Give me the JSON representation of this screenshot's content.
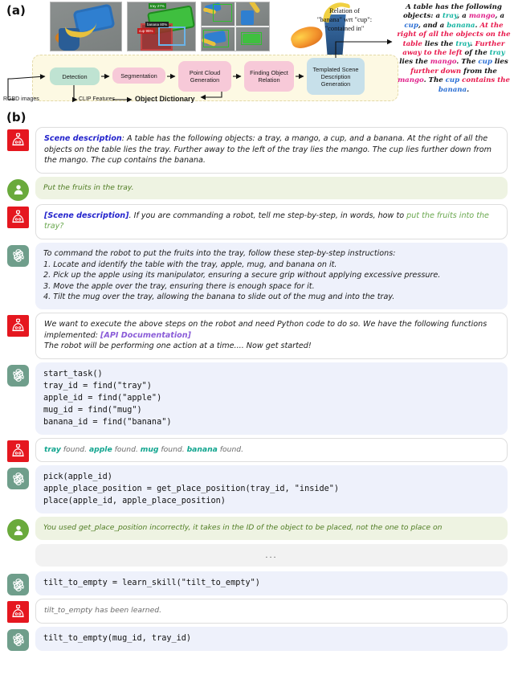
{
  "panels": {
    "a": "(a)",
    "b": "(b)"
  },
  "pipeline": {
    "boxes": [
      {
        "id": "detection",
        "label": "Detection",
        "color": "#bfe3d2"
      },
      {
        "id": "segmentation",
        "label": "Segmentation",
        "color": "#f7c9d8"
      },
      {
        "id": "pointcloud",
        "label": "Point Cloud Generation",
        "color": "#f7c9d8"
      },
      {
        "id": "relation",
        "label": "Finding Object Relation",
        "color": "#f7c9d8"
      },
      {
        "id": "templated",
        "label": "Templated Scene Description Generation",
        "color": "#c7e0ea"
      }
    ],
    "input_label": "RGBD images",
    "clip_label": "CLIP Features",
    "object_dictionary_label": "Object Dictionary"
  },
  "relation_note": {
    "line1": "Relation of",
    "line2": "\"banana\" wrt \"cup\":",
    "line3": "\"contained in\""
  },
  "detection_tags": {
    "tray": "tray 27%",
    "banana": "banana 80%",
    "cup": "cup 95%"
  },
  "scene_description_colored": {
    "segments": [
      {
        "text": "A table has the following objects: a ",
        "color": "plain"
      },
      {
        "text": "tray",
        "color": "teal"
      },
      {
        "text": ", a ",
        "color": "plain"
      },
      {
        "text": "mango",
        "color": "pink"
      },
      {
        "text": ", a ",
        "color": "plain"
      },
      {
        "text": "cup",
        "color": "blue"
      },
      {
        "text": ", and a ",
        "color": "plain"
      },
      {
        "text": "banana",
        "color": "teal"
      },
      {
        "text": ". ",
        "color": "plain"
      },
      {
        "text": "At the right of all the objects on the table",
        "color": "crimson"
      },
      {
        "text": " lies the ",
        "color": "plain"
      },
      {
        "text": "tray",
        "color": "teal"
      },
      {
        "text": ". ",
        "color": "plain"
      },
      {
        "text": "Further away to the left",
        "color": "crimson"
      },
      {
        "text": " of the ",
        "color": "plain"
      },
      {
        "text": "tray",
        "color": "teal"
      },
      {
        "text": " lies the ",
        "color": "plain"
      },
      {
        "text": "mango",
        "color": "pink"
      },
      {
        "text": ". The ",
        "color": "plain"
      },
      {
        "text": "cup",
        "color": "blue"
      },
      {
        "text": " lies ",
        "color": "plain"
      },
      {
        "text": "further down",
        "color": "crimson"
      },
      {
        "text": " from the ",
        "color": "plain"
      },
      {
        "text": "mango",
        "color": "pink"
      },
      {
        "text": ". The ",
        "color": "plain"
      },
      {
        "text": "cup",
        "color": "blue"
      },
      {
        "text": " contains the ",
        "color": "crimson"
      },
      {
        "text": "banana",
        "color": "blue"
      },
      {
        "text": ".",
        "color": "plain"
      }
    ]
  },
  "conversation": [
    {
      "id": "msg-scene-description",
      "role": "robot",
      "kind": "rich",
      "label": "Scene description",
      "text": ": A table has the following objects: a tray, a mango, a cup, and a banana. At the right of all the objects on the table lies the tray. Further away to the left of the tray lies the mango. The cup lies further down from the mango. The cup contains the banana."
    },
    {
      "id": "msg-user-put-fruits",
      "role": "user",
      "kind": "text",
      "text": "Put the fruits in the tray."
    },
    {
      "id": "msg-robot-prompt",
      "role": "robot",
      "kind": "prompt",
      "prefix": "[Scene description]",
      "mid": ". If you are commanding a robot, tell me step-by-step, in words, how to ",
      "highlight": "put the fruits into the tray?"
    },
    {
      "id": "msg-gpt-steps",
      "role": "gpt",
      "kind": "steps",
      "intro": "To command the robot to put the fruits into the tray, follow these step-by-step instructions:",
      "steps": [
        "1. Locate and identify the table with the tray, apple, mug, and banana on it.",
        "2. Pick up the apple using its manipulator, ensuring a secure grip without applying excessive pressure.",
        "3. Move the apple over the tray, ensuring there is enough space for it.",
        "4. Tilt the mug over the tray, allowing the banana to slide out of the mug and into the tray."
      ]
    },
    {
      "id": "msg-robot-api",
      "role": "robot",
      "kind": "api",
      "line1a": "We want to execute the above steps on the robot and need Python code to do so. We have the following functions implemented: ",
      "api_link": "[API Documentation]",
      "line2": "The robot will be performing one action at a time.... Now get started!"
    },
    {
      "id": "msg-gpt-code-find",
      "role": "gpt",
      "kind": "code",
      "code": "start_task()\ntray_id = find(\"tray\")\napple_id = find(\"apple\")\nmug_id = find(\"mug\")\nbanana_id = find(\"banana\")"
    },
    {
      "id": "msg-robot-found",
      "role": "robot",
      "kind": "found",
      "items": [
        "tray",
        "apple",
        "mug",
        "banana"
      ],
      "suffix": " found."
    },
    {
      "id": "msg-gpt-code-pick",
      "role": "gpt",
      "kind": "code",
      "code": "pick(apple_id)\napple_place_position = get_place_position(tray_id, \"inside\")\nplace(apple_id, apple_place_position)"
    },
    {
      "id": "msg-user-correction",
      "role": "user",
      "kind": "text",
      "text": "You used get_place_position incorrectly, it takes in the ID of the object to be placed, not the one to place on"
    },
    {
      "id": "msg-ellipsis",
      "role": "none",
      "kind": "ellipsis",
      "text": "..."
    },
    {
      "id": "msg-gpt-learn-skill",
      "role": "gpt",
      "kind": "code",
      "code": "tilt_to_empty = learn_skill(\"tilt_to_empty\")"
    },
    {
      "id": "msg-robot-learned",
      "role": "robot",
      "kind": "system",
      "text": "tilt_to_empty has been learned."
    },
    {
      "id": "msg-gpt-tilt-call",
      "role": "gpt",
      "kind": "code",
      "code": "tilt_to_empty(mug_id, tray_id)"
    }
  ],
  "colors": {
    "robot_avatar": "#e5171f",
    "user_avatar": "#6aaa3c",
    "gpt_avatar": "#6f9e8b",
    "user_bubble": "#eef3e2",
    "gpt_bubble": "#eef1fb",
    "robot_bubble": "#ffffff",
    "teal": "#12b3a0",
    "pink": "#e0218a",
    "blue": "#2b6fd4",
    "crimson": "#e8174b",
    "api_link": "#8a5cd8",
    "scene_label": "#2222cc",
    "user_text": "#4f7c23"
  }
}
